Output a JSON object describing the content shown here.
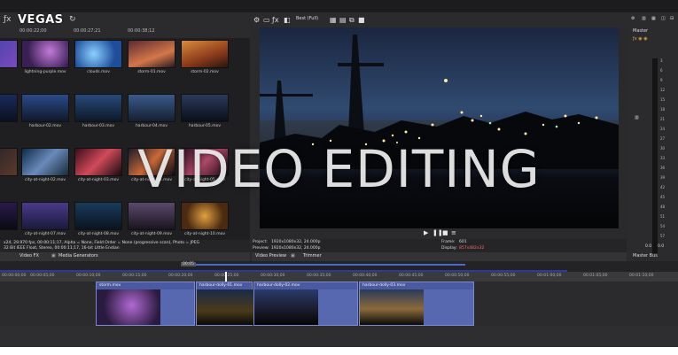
{
  "app": {
    "logo": "VEGAS"
  },
  "media_panel": {
    "timestamps": [
      "00:00:22;00",
      "00:00:27;21",
      "00:00:38;12"
    ],
    "clips": [
      [
        "mov",
        "lightning-purple.mov",
        "clouds.mov",
        "storm-01.mov",
        "storm-02.mov"
      ],
      [
        "mov",
        "harbour-02.mov",
        "harbour-03.mov",
        "harbour-04.mov",
        "harbour-05.mov"
      ],
      [
        "mov",
        "city-at-night-02.mov",
        "city-at-night-03.mov",
        "city-at-night-04.mov",
        "city-at-night-05.mov"
      ],
      [
        "mov",
        "city-at-night-07.mov",
        "city-at-night-08.mov",
        "city-at-night-09.mov",
        "city-at-night-10.mov"
      ]
    ],
    "info_lines": [
      "x24, 29.970 fps, 00:00:11;17, Alpha = None, Field Order = None (progressive scan), Photo = JPEG",
      "32 Bit IEEE Float, Stereo, 00:00:11;17, 16-bit Little Endian"
    ],
    "tabs": [
      "Video FX",
      "Media Generators"
    ]
  },
  "preview": {
    "quality": "Best (Full)",
    "project_label": "Project:",
    "project_value": "1920x1080x32, 24.000p",
    "preview_label": "Preview:",
    "preview_value": "1920x1080x32, 24.000p",
    "frame_label": "Frame:",
    "frame_value": "601",
    "display_label": "Display:",
    "display_value": "857x482x32",
    "tabs": [
      "Video Preview",
      "Trimmer"
    ]
  },
  "master": {
    "title": "Master",
    "bus_label": "Master Bus",
    "db_marks": [
      "3",
      "6",
      "9",
      "12",
      "15",
      "18",
      "21",
      "24",
      "27",
      "30",
      "33",
      "36",
      "39",
      "42",
      "45",
      "48",
      "51",
      "54",
      "57"
    ],
    "readouts": [
      "0.0",
      "0.0"
    ]
  },
  "timeline": {
    "position": "00:05",
    "ruler": [
      "00:00:00;00",
      "00:00:05;00",
      "00:00:10;00",
      "00:00:15;00",
      "00:00:20;00",
      "00:00:25;00",
      "00:00:30;00",
      "00:00:35;00",
      "00:00:40;00",
      "00:00:45;00",
      "00:00:50;00",
      "00:00:55;00",
      "00:01:00;00",
      "00:01:05;00",
      "00:01:10;00"
    ],
    "clips": [
      "storm.mov",
      "harbour-dolly-01.mov",
      "harbour-dolly-02.mov",
      "harbour-dolly-03.mov"
    ]
  },
  "overlay_title": "VIDEO EDITING"
}
